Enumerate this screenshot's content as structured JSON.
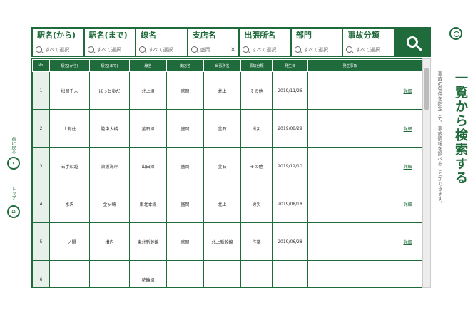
{
  "filters": [
    {
      "title": "駅名(から)",
      "placeholder": "すべて選択",
      "value": "",
      "has_clear": false
    },
    {
      "title": "駅名(まで)",
      "placeholder": "すべて選択",
      "value": "",
      "has_clear": false
    },
    {
      "title": "線名",
      "placeholder": "すべて選択",
      "value": "",
      "has_clear": false
    },
    {
      "title": "支店名",
      "placeholder": "",
      "value": "盛岡",
      "has_clear": true
    },
    {
      "title": "出張所名",
      "placeholder": "すべて選択",
      "value": "",
      "has_clear": false
    },
    {
      "title": "部門",
      "placeholder": "すべて選択",
      "value": "",
      "has_clear": false
    },
    {
      "title": "事故分類",
      "placeholder": "すべて選択",
      "value": "",
      "has_clear": false
    }
  ],
  "table": {
    "headers": [
      "No.",
      "駅名(から)",
      "駅名(まで)",
      "線名",
      "支店名",
      "出張所名",
      "事故分類",
      "発生日",
      "発生事象",
      ""
    ],
    "rows": [
      {
        "no": "1",
        "from": "松岡千人",
        "to": "ほっとゆだ",
        "line": "北上線",
        "branch": "盛岡",
        "office": "北上",
        "type": "その他",
        "date": "2019/11/26",
        "detail": "詳細"
      },
      {
        "no": "2",
        "from": "上有住",
        "to": "陸中大橋",
        "line": "釜石線",
        "branch": "盛岡",
        "office": "釜石",
        "type": "労災",
        "date": "2019/08/29",
        "detail": "詳細"
      },
      {
        "no": "3",
        "from": "岩手船越",
        "to": "浪板海岸",
        "line": "山田線",
        "branch": "盛岡",
        "office": "釜石",
        "type": "その他",
        "date": "2019/12/10",
        "detail": "詳細"
      },
      {
        "no": "4",
        "from": "水沢",
        "to": "金ヶ崎",
        "line": "東北本線",
        "branch": "盛岡",
        "office": "北上",
        "type": "労災",
        "date": "2019/08/18",
        "detail": "詳細"
      },
      {
        "no": "5",
        "from": "一ノ関",
        "to": "構内",
        "line": "東北新幹線",
        "branch": "盛岡",
        "office": "北上新幹線",
        "type": "作業",
        "date": "2019/06/28",
        "detail": "詳細"
      },
      {
        "no": "6",
        "from": "",
        "to": "",
        "line": "花輪線",
        "branch": "",
        "office": "",
        "type": "",
        "date": "",
        "detail": ""
      }
    ]
  },
  "right_panel": {
    "title": "一覧から検索する",
    "description": "事故の条件を指定して、事故情報を調べることができます。"
  },
  "left_nav": {
    "back_label": "前に戻る",
    "top_label": "トップ"
  }
}
